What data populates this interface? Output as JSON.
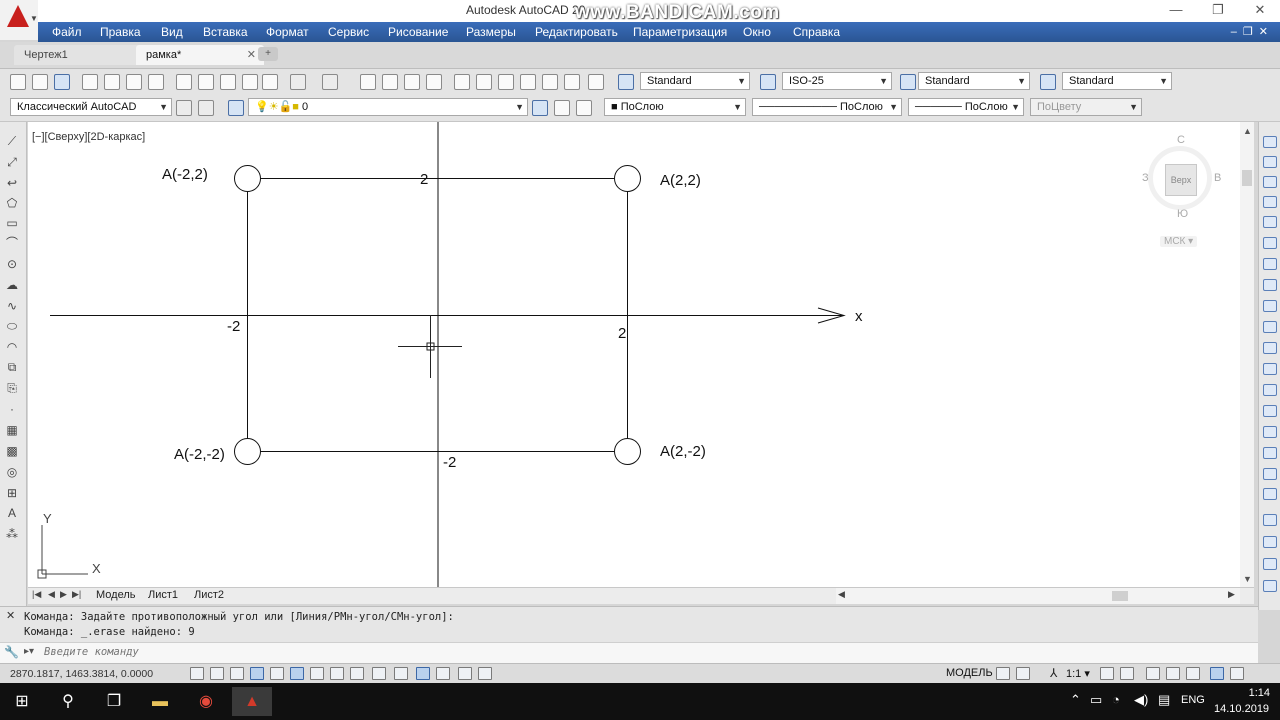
{
  "window": {
    "title": "Autodesk AutoCAD 20",
    "watermark": "www.BANDICAM.com",
    "min": "—",
    "max": "❐",
    "close": "✕"
  },
  "menu": {
    "items": [
      "Файл",
      "Правка",
      "Вид",
      "Вставка",
      "Формат",
      "Сервис",
      "Рисование",
      "Размеры",
      "Редактировать",
      "Параметризация",
      "Окно",
      "Справка"
    ],
    "doc_controls": "–❐✕"
  },
  "tabs": {
    "items": [
      {
        "label": "Чертеж1"
      },
      {
        "label": "рамка*"
      }
    ],
    "close": "✕",
    "new": "+"
  },
  "toolbar1": {
    "text_style": "Standard",
    "dim_style": "ISO-25",
    "table_style": "Standard",
    "mleader_style": "Standard"
  },
  "toolbar2": {
    "workspace": "Классический AutoCAD",
    "layer": "0",
    "color": "ПоСлою",
    "linetype": "ПоСлою",
    "lineweight": "ПоСлою",
    "plotstyle": "ПоЦвету"
  },
  "viewport": {
    "label": "[−][Сверху][2D-каркас]"
  },
  "viewcube": {
    "north": "С",
    "south": "Ю",
    "west": "З",
    "east": "В",
    "face": "Верх",
    "wcs": "МСК ▾"
  },
  "drawing": {
    "x_axis_label": "x",
    "labels": {
      "tl": "A(-2,2)",
      "tr": "A(2,2)",
      "bl": "A(-2,-2)",
      "br": "A(2,-2)",
      "top": "2",
      "left": "-2",
      "right": "2",
      "bottom": "-2"
    },
    "ucs": {
      "x": "X",
      "y": "Y"
    }
  },
  "layout_tabs": [
    "Модель",
    "Лист1",
    "Лист2"
  ],
  "command": {
    "history": [
      "Команда: Задайте противоположный угол или [Линия/РМн-угол/СМн-угол]:",
      "Команда: _.erase найдено: 9"
    ],
    "placeholder": "Введите команду",
    "close": "✕"
  },
  "status": {
    "coords": "2870.1817, 1463.3814, 0.0000",
    "model": "МОДЕЛЬ",
    "scale": "1:1 ▾"
  },
  "taskbar": {
    "time": "1:14",
    "date": "14.10.2019",
    "lang": "ENG"
  },
  "colors": {
    "menu_bg": "#2b579a",
    "app_red": "#c8201d",
    "taskbar": "#101010"
  }
}
